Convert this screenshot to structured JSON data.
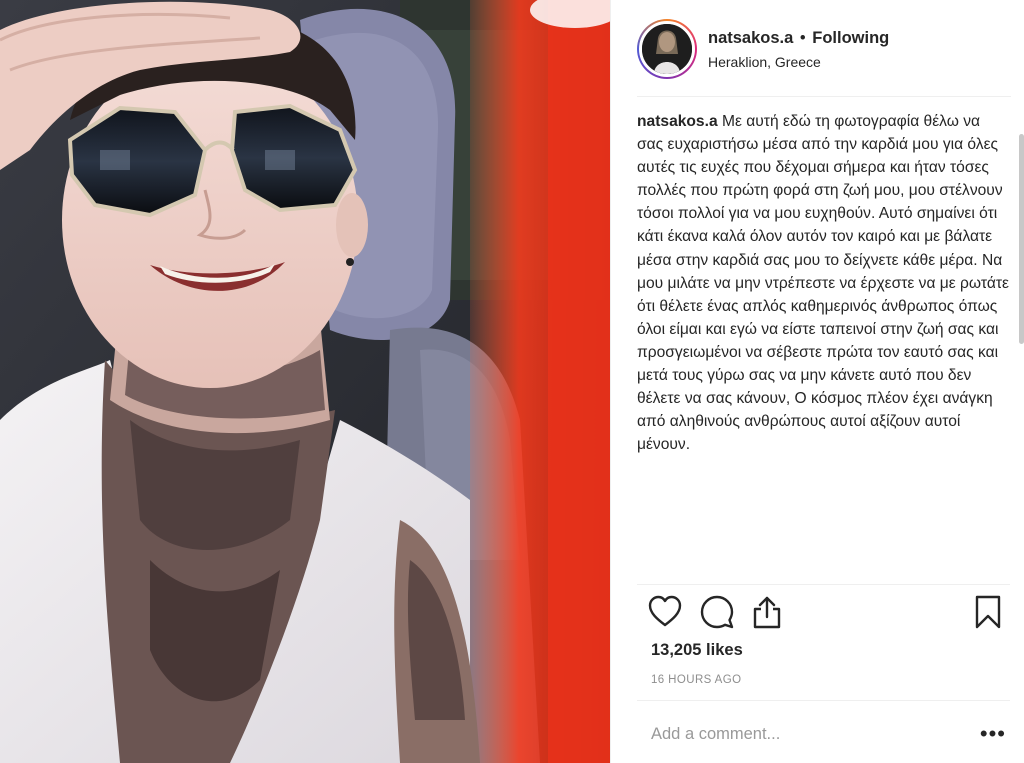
{
  "header": {
    "username": "natsakos.a",
    "separator": "•",
    "follow_status": "Following",
    "location": "Heraklion, Greece"
  },
  "caption": {
    "username": "natsakos.a",
    "text": "Με αυτή εδώ τη φωτογραφία θέλω να σας ευχαριστήσω μέσα από την καρδιά μου για όλες αυτές τις ευχές που δέχομαι σήμερα και ήταν τόσες πολλές που πρώτη φορά στη ζωή μου, μου στέλνουν τόσοι πολλοί για να μου ευχηθούν. Αυτό σημαίνει ότι κάτι έκανα καλά όλον αυτόν τον καιρό και με βάλατε μέσα στην καρδιά σας μου το δείχνετε κάθε μέρα. Να μου μιλάτε να μην ντρέπεστε να έρχεστε να με ρωτάτε ότι θέλετε ένας απλός καθημερινός άνθρωπος όπως όλοι είμαι και εγώ να είστε ταπεινοί στην ζωή σας και προσγειωμένοι να σέβεστε πρώτα τον εαυτό σας και μετά τους γύρω σας να μην κάνετε αυτό που δεν θέλετε να σας κάνουν, Ο κόσμος πλέον έχει ανάγκη από αληθινούς ανθρώπους αυτοί αξίζουν αυτοί μένουν."
  },
  "actions": {
    "like_icon": "heart-outline-icon",
    "comment_icon": "speech-bubble-icon",
    "share_icon": "share-upload-icon",
    "save_icon": "bookmark-icon"
  },
  "likes": "13,205 likes",
  "timestamp": "16 HOURS AGO",
  "comment_box": {
    "placeholder": "Add a comment...",
    "more_label": "•••"
  },
  "colors": {
    "text": "#262626",
    "muted": "#8e8e8e",
    "divider": "#efefef",
    "photo_red_streak": "#e8321b"
  }
}
